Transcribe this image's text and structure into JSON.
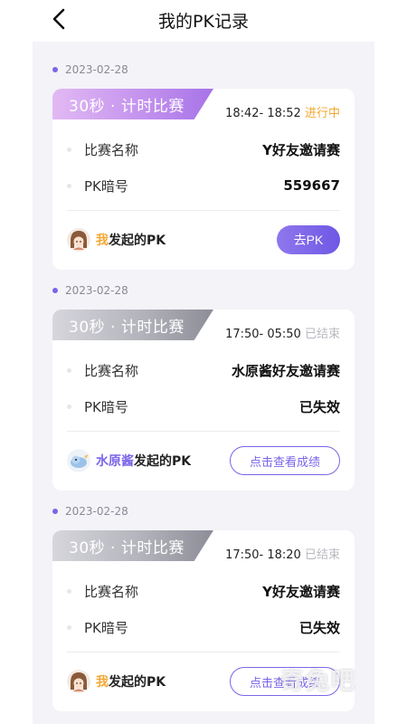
{
  "header": {
    "title": "我的PK记录"
  },
  "records": [
    {
      "date": "2023-02-28",
      "tag": "30秒 · 计时比赛",
      "time": "18:42- 18:52",
      "status": "进行中",
      "name_label": "比赛名称",
      "name_value": "Y好友邀请赛",
      "code_label": "PK暗号",
      "code_value": "559667",
      "initiator_name": "我",
      "initiator_suffix": "发起的PK",
      "action_label": "去PK"
    },
    {
      "date": "2023-02-28",
      "tag": "30秒 · 计时比赛",
      "time": "17:50- 05:50",
      "status": "已结束",
      "name_label": "比赛名称",
      "name_value": "水原酱好友邀请赛",
      "code_label": "PK暗号",
      "code_value": "已失效",
      "initiator_name": "水原酱",
      "initiator_suffix": "发起的PK",
      "action_label": "点击查看成绩"
    },
    {
      "date": "2023-02-28",
      "tag": "30秒 · 计时比赛",
      "time": "17:50- 18:20",
      "status": "已结束",
      "name_label": "比赛名称",
      "name_value": "Y好友邀请赛",
      "code_label": "PK暗号",
      "code_value": "已失效",
      "initiator_name": "我",
      "initiator_suffix": "发起的PK",
      "action_label": "点击查看成绩"
    }
  ],
  "watermark": "奇兔吧",
  "colors": {
    "accent": "#7c65e8",
    "ongoing": "#f3a733",
    "ended": "#b8b8c0"
  },
  "icons": {
    "back": "chevron-left-icon",
    "avatar_me": "girl-avatar-icon",
    "avatar_other": "blue-bird-avatar-icon"
  }
}
